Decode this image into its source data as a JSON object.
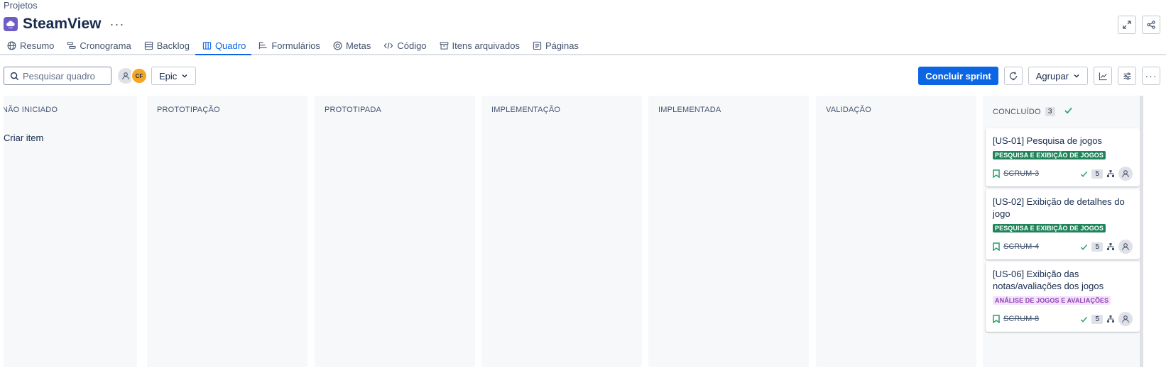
{
  "breadcrumb": "Projetos",
  "project": {
    "title": "SteamView",
    "icon": "cloud-icon",
    "icon_color": "#6e5dc6"
  },
  "tabs": [
    {
      "label": "Resumo",
      "icon": "globe-icon"
    },
    {
      "label": "Cronograma",
      "icon": "timeline-icon"
    },
    {
      "label": "Backlog",
      "icon": "backlog-icon"
    },
    {
      "label": "Quadro",
      "icon": "board-icon",
      "active": true
    },
    {
      "label": "Formulários",
      "icon": "form-icon"
    },
    {
      "label": "Metas",
      "icon": "target-icon"
    },
    {
      "label": "Código",
      "icon": "code-icon"
    },
    {
      "label": "Itens arquivados",
      "icon": "archive-icon"
    },
    {
      "label": "Páginas",
      "icon": "page-icon"
    }
  ],
  "toolbar": {
    "search_placeholder": "Pesquisar quadro",
    "avatar_initials": "CF",
    "epic_label": "Epic",
    "complete_sprint": "Concluir sprint",
    "group_label": "Agrupar"
  },
  "columns": [
    {
      "title": "NÃO INICIADO",
      "create_label": "Criar item"
    },
    {
      "title": "PROTOTIPAÇÃO"
    },
    {
      "title": "PROTOTIPADA"
    },
    {
      "title": "IMPLEMENTAÇÃO"
    },
    {
      "title": "IMPLEMENTADA"
    },
    {
      "title": "VALIDAÇÃO"
    },
    {
      "title": "CONCLUÍDO",
      "count": "3"
    }
  ],
  "cards": [
    {
      "title": "[US-01] Pesquisa de jogos",
      "epic": "PESQUISA E EXIBIÇÃO DE JOGOS",
      "epic_bg": "#1f845a",
      "epic_fg": "#ffffff",
      "key": "SCRUM-3",
      "estimate": "5"
    },
    {
      "title": "[US-02] Exibição de detalhes do jogo",
      "epic": "PESQUISA E EXIBIÇÃO DE JOGOS",
      "epic_bg": "#1f845a",
      "epic_fg": "#ffffff",
      "key": "SCRUM-4",
      "estimate": "5"
    },
    {
      "title": "[US-06] Exibição das notas/avaliações dos jogos",
      "epic": "ANÁLISE DE JOGOS E AVALIAÇÕES",
      "epic_bg": "#f3e0fc",
      "epic_fg": "#8f3fb3",
      "key": "SCRUM-8",
      "estimate": "5"
    }
  ],
  "colors": {
    "accent": "#0c66e4",
    "done_check": "#22a06b"
  }
}
